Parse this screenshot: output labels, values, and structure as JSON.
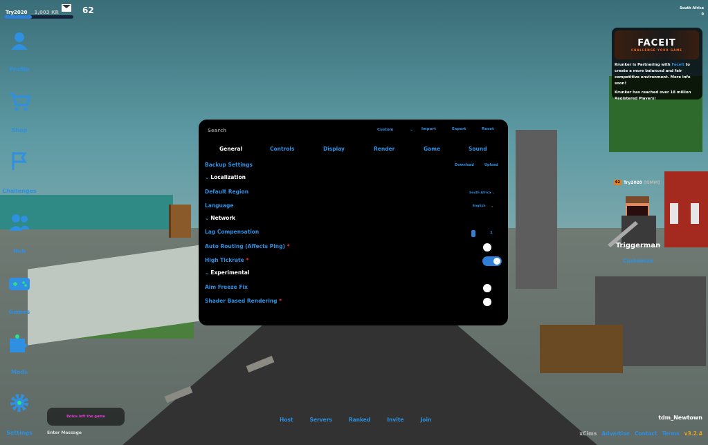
{
  "user": {
    "name": "Try2020",
    "kr": "1,003 KR",
    "level": "62",
    "xp_progress": 0.4
  },
  "menu": [
    {
      "label": "Profile",
      "icon": "profile-icon"
    },
    {
      "label": "Shop",
      "icon": "cart-icon"
    },
    {
      "label": "Challenges",
      "icon": "flag-icon"
    },
    {
      "label": "Hub",
      "icon": "people-icon"
    },
    {
      "label": "Games",
      "icon": "gamepad-icon"
    },
    {
      "label": "Mods",
      "icon": "puzzle-icon"
    },
    {
      "label": "Settings",
      "icon": "gear-icon"
    }
  ],
  "region": {
    "name": "South Africa",
    "ping": "0"
  },
  "news": {
    "logo": "FACEIT",
    "tagline": "CHALLENGE YOUR GAME",
    "line1_pre": "Krunker is Partnering with ",
    "line1_link": "Faceit",
    "line1_post": " to create a more balanced and fair competitive environment. More info soon!",
    "line2": "Krunker has reached over 18 million Registered Players!"
  },
  "player": {
    "level": "62",
    "name": "Try2020",
    "clan": "[GMM]",
    "class": "Triggerman",
    "customize": "Customize"
  },
  "settings": {
    "search_placeholder": "Search",
    "preset": "Custom",
    "import": "Import",
    "export": "Export",
    "reset": "Reset",
    "tabs": [
      "General",
      "Controls",
      "Display",
      "Render",
      "Game",
      "Sound"
    ],
    "backup_label": "Backup Settings",
    "download": "Download",
    "upload": "Upload",
    "localization": "Localization",
    "default_region": "Default Region",
    "default_region_value": "South Africa",
    "language": "Language",
    "language_value": "English",
    "network": "Network",
    "lag_compensation": "Lag Compensation",
    "lag_value": "1",
    "auto_routing": "Auto Routing (Affects Ping)",
    "high_tickrate": "High Tickrate",
    "experimental": "Experimental",
    "aim_freeze": "Aim Freeze Fix",
    "shader": "Shader Based Rendering",
    "required_mark": "*",
    "toggles": {
      "auto_routing": false,
      "high_tickrate": true,
      "aim_freeze": false,
      "shader": false
    }
  },
  "chat": {
    "message": "Botos left the game",
    "input_placeholder": "Enter Message"
  },
  "bottom_links": [
    "Host",
    "Servers",
    "Ranked",
    "Invite",
    "Join"
  ],
  "map_name": "tdm_Newtown",
  "footer": {
    "brand": "xCims",
    "advertise": "Advertise",
    "contact": "Contact",
    "terms": "Terms",
    "version": "v3.2.4"
  },
  "colors": {
    "accent": "#2f8fe0",
    "chat": "#e03bd3",
    "version": "#e0a32a"
  }
}
